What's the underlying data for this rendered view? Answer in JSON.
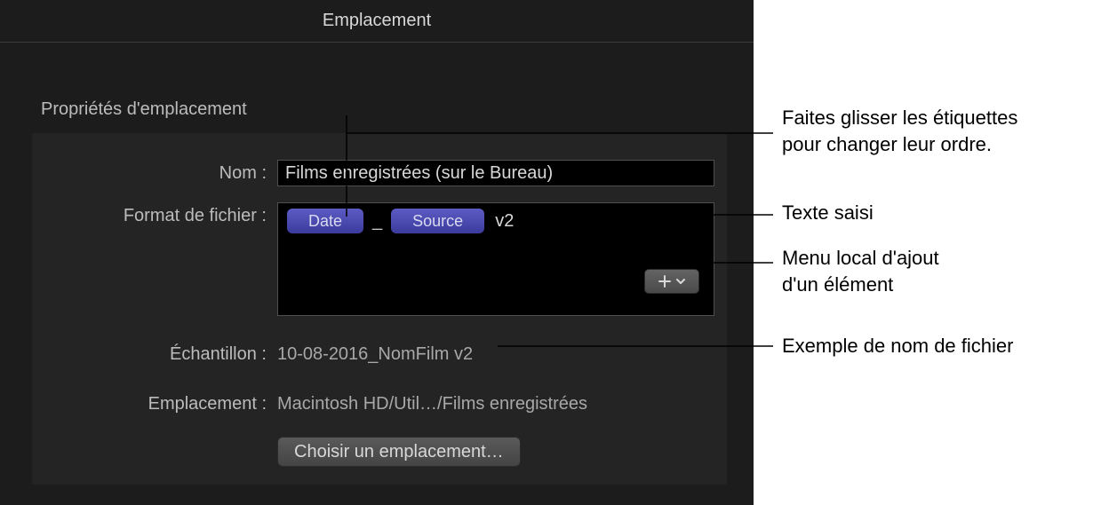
{
  "header": {
    "title": "Emplacement"
  },
  "section": {
    "title": "Propriétés d'emplacement"
  },
  "labels": {
    "name": "Nom :",
    "format": "Format de fichier :",
    "sample": "Échantillon :",
    "location": "Emplacement :"
  },
  "name_input": {
    "value": "Films enregistrées (sur le Bureau)"
  },
  "format": {
    "tokens": [
      "Date",
      "Source"
    ],
    "separator": "_",
    "typed_suffix": "v2"
  },
  "sample": {
    "value": "10-08-2016_NomFilm v2"
  },
  "location": {
    "path": "Macintosh HD/Util…/Films enregistrées"
  },
  "choose_button": {
    "label": "Choisir un emplacement…"
  },
  "callouts": {
    "drag": "Faites glisser les étiquettes\npour changer leur ordre.",
    "typed": "Texte saisi",
    "add_menu": "Menu local d'ajout\nd'un élément",
    "sample": "Exemple de nom de fichier"
  },
  "icons": {
    "plus": "plus",
    "chevron_down": "chevron-down"
  }
}
